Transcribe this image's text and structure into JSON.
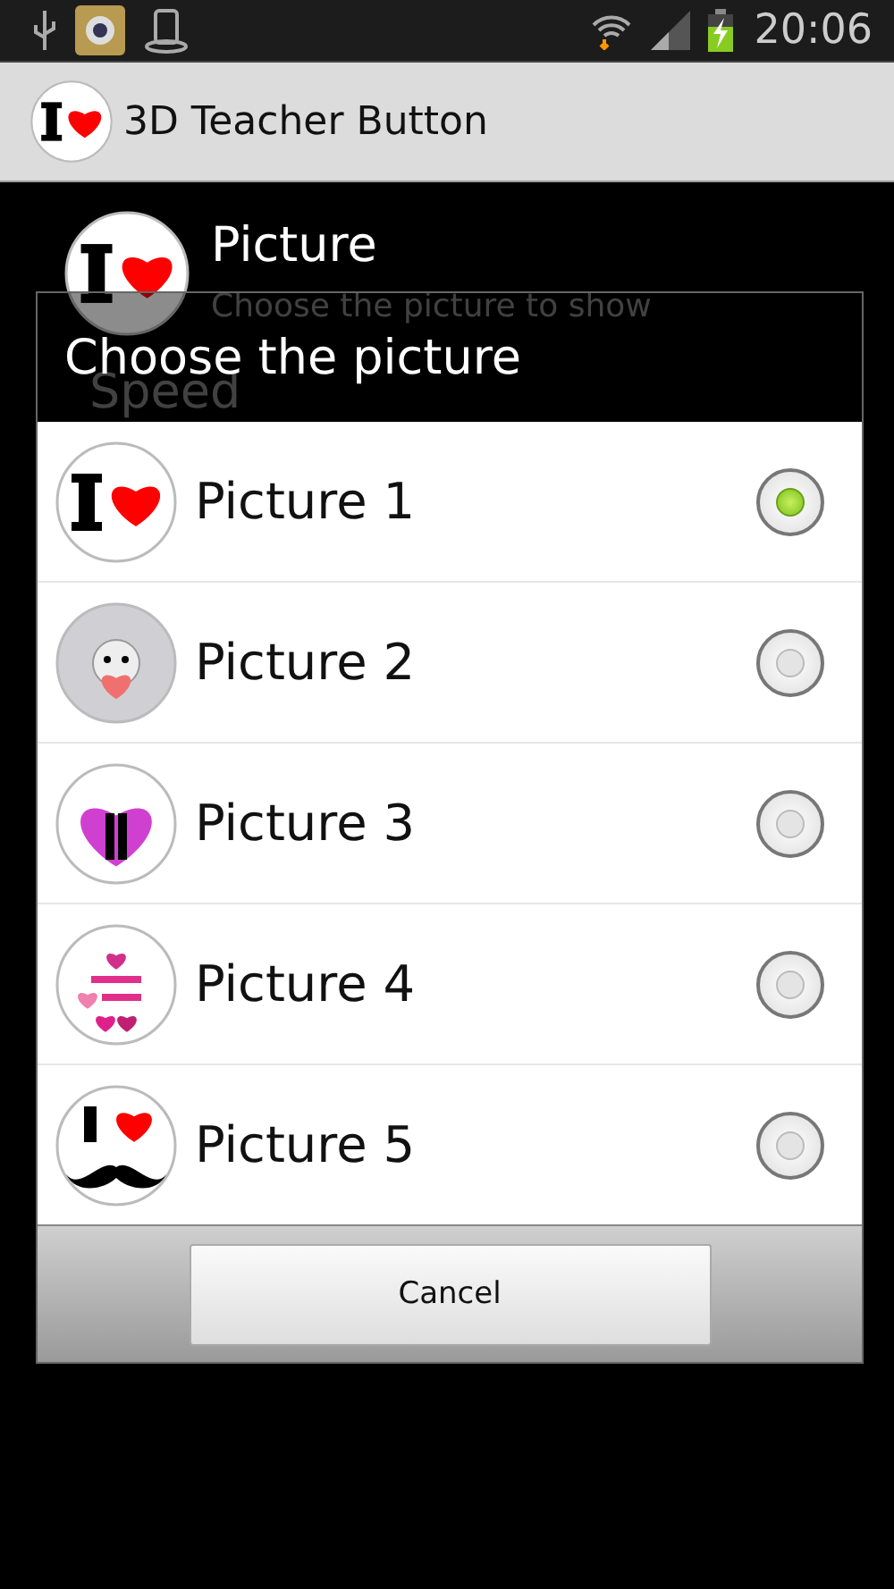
{
  "status_bar": {
    "time": "20:06"
  },
  "action_bar": {
    "title": "3D Teacher Button"
  },
  "preferences": [
    {
      "title": "Picture",
      "summary": "Choose the picture to show",
      "kind": "heart"
    },
    {
      "title": "Speed"
    }
  ],
  "dialog": {
    "title": "Choose the picture",
    "options": [
      {
        "label": "Picture 1",
        "kind": "heart",
        "selected": true
      },
      {
        "label": "Picture 2",
        "kind": "bear",
        "selected": false
      },
      {
        "label": "Picture 3",
        "kind": "couple",
        "selected": false
      },
      {
        "label": "Picture 4",
        "kind": "hearts",
        "selected": false
      },
      {
        "label": "Picture 5",
        "kind": "mustache",
        "selected": false
      }
    ],
    "buttons": [
      "Cancel"
    ]
  }
}
